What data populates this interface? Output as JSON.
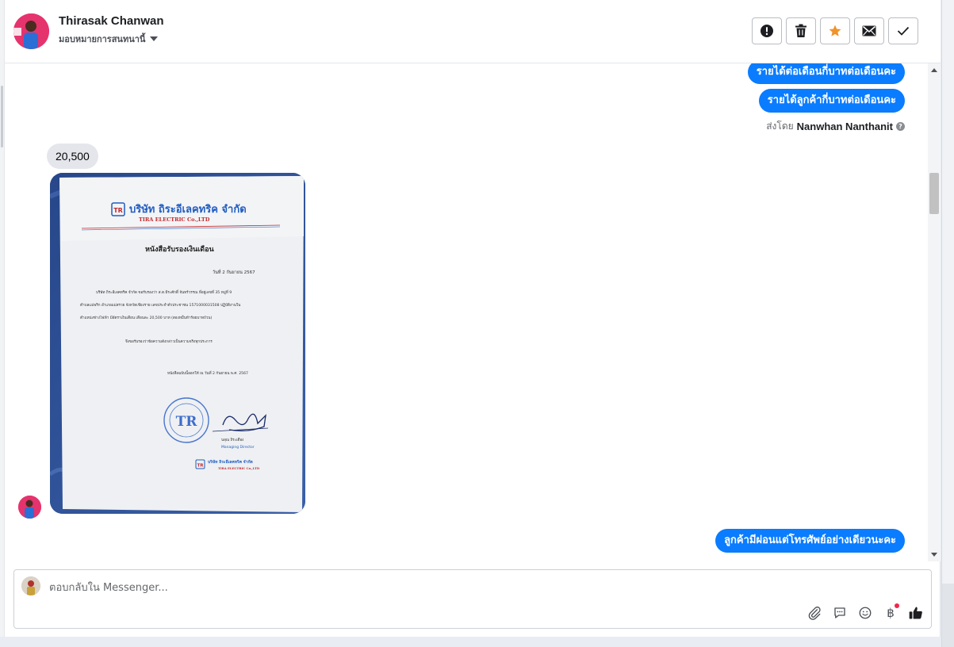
{
  "header": {
    "contact_name": "Thirasak Chanwan",
    "assign_label": "มอบหมายการสนทนานี้",
    "actions": [
      {
        "name": "mark-spam-button",
        "icon": "alert-icon"
      },
      {
        "name": "delete-button",
        "icon": "trash-icon"
      },
      {
        "name": "star-button",
        "icon": "star-icon"
      },
      {
        "name": "mark-unread-button",
        "icon": "envelope-icon"
      },
      {
        "name": "mark-done-button",
        "icon": "check-icon"
      }
    ]
  },
  "conversation": {
    "outgoing_1": "รายได้ต่อเดือนกี่บาทต่อเดือนคะ",
    "outgoing_2": "รายได้ลูกค้ากี่บาทต่อเดือนคะ",
    "sent_by_prefix": "ส่งโดย",
    "sent_by_name": "Nanwhan Nanthanit",
    "incoming_text": "20,500",
    "document": {
      "company_th": "บริษัท ถิระอีเลคทริค จำกัด",
      "company_en": "TIRA ELECTRIC Co.,LTD",
      "title_th": "หนังสือรับรองเงินเดือน",
      "date_line": "วันที่ 2 กันยายน 2567",
      "body_line_1": "บริษัท ถิระอีเลคทริค จำกัด ขอรับรองว่า ส.ต.ธีระศักดิ์ จันทร์วรรณ ที่อยู่เลขที่ 35 หมู่ที่ 9",
      "body_line_2": "ตำบลแม่พริก อำเภอแม่สรวย จังหวัดเชียงราย เลขประจำตัวประชาชน 1571000031508 ปฏิบัติงานใน",
      "body_line_3": "ตำแหน่งช่างไฟฟ้า มีอัตราเงินเดือน เดือนละ 20,500 บาท (สองหมื่นห้าร้อยบาทถ้วน)",
      "body_line_4": "จึงขอรับรองว่าข้อความดังกล่าวเป็นความจริงทุกประการ",
      "issue_line": "หนังสือฉบับนี้ออกให้ ณ วันที่ 2 กันยายน พ.ศ. 2567",
      "seal_text": "TR",
      "signer_name": "นลุณ ถิระเดือง",
      "signer_title": "Managing Director"
    },
    "outgoing_3": "ลูกค้ามีผ่อนแต่โทรศัพย์อย่างเดียวนะคะ"
  },
  "composer": {
    "placeholder": "ตอบกลับใน Messenger...",
    "baht_symbol": "฿",
    "tools": [
      "paperclip-icon",
      "saved-reply-icon",
      "emoji-icon",
      "baht-icon",
      "thumbs-up-icon"
    ]
  },
  "colors": {
    "accent": "#0a7cff",
    "star": "#f0932b",
    "incoming_bubble": "#e4e6eb",
    "notification_dot": "#f0284a"
  }
}
